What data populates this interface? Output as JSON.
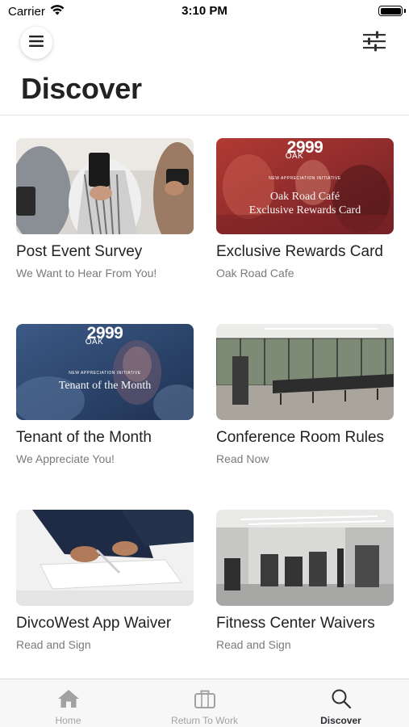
{
  "status_bar": {
    "carrier": "Carrier",
    "time": "3:10 PM"
  },
  "header": {
    "title": "Discover",
    "menu_icon": "hamburger-icon",
    "filter_icon": "sliders-icon"
  },
  "cards": [
    {
      "title": "Post Event Survey",
      "subtitle": "We Want to Hear From You!"
    },
    {
      "title": "Exclusive Rewards Card",
      "subtitle": "Oak Road Cafe",
      "image_text": {
        "logo_number": "2999",
        "logo_word": "OAK",
        "kicker": "NEW APPRECIATION INITIATIVE",
        "line1": "Oak Road Café",
        "line2": "Exclusive Rewards Card"
      }
    },
    {
      "title": "Tenant of the Month",
      "subtitle": "We Appreciate You!",
      "image_text": {
        "logo_number": "2999",
        "logo_word": "OAK",
        "kicker": "NEW APPRECIATION INITIATIVE",
        "line1": "Tenant of the Month"
      }
    },
    {
      "title": "Conference Room Rules",
      "subtitle": "Read Now"
    },
    {
      "title": "DivcoWest App Waiver",
      "subtitle": "Read and Sign"
    },
    {
      "title": "Fitness Center Waivers",
      "subtitle": "Read and Sign"
    }
  ],
  "tabbar": {
    "tabs": [
      {
        "label": "Home",
        "icon": "home-icon",
        "active": false
      },
      {
        "label": "Return To Work",
        "icon": "briefcase-icon",
        "active": false
      },
      {
        "label": "Discover",
        "icon": "search-icon",
        "active": true
      }
    ]
  },
  "colors": {
    "active_tab": "#2b2d31",
    "inactive_tab": "#a2a2a2",
    "subtitle": "#7a7a7a",
    "rewards_red": "#8e2a2c",
    "tenant_blue": "#2b4266"
  }
}
